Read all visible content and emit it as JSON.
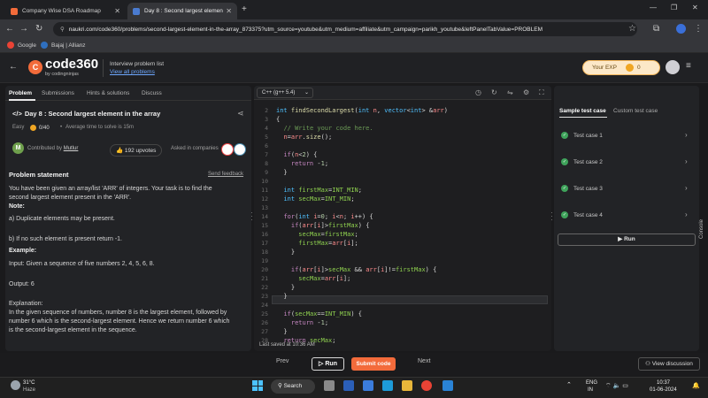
{
  "browser": {
    "tabs": [
      {
        "title": "Company Wise DSA Roadmap"
      },
      {
        "title": "Day 8 : Second largest elemen"
      }
    ],
    "url": "naukri.com/code360/problems/second-largest-element-in-the-array_873375?utm_source=youtube&utm_medium=affiliate&utm_campaign=parikh_youtube&leftPanelTabValue=PROBLEM",
    "bookmarks": [
      {
        "label": "Google"
      },
      {
        "label": "Bajaj | Allianz"
      }
    ]
  },
  "site": {
    "logo_text": "code360",
    "logo_sub": "by codingninjas",
    "ipl_title": "Interview problem list",
    "ipl_link": "View all problems",
    "exp_label": "Your EXP",
    "exp_value": "0"
  },
  "left_panel": {
    "tabs": [
      {
        "label": "Problem"
      },
      {
        "label": "Submissions"
      },
      {
        "label": "Hints & solutions"
      },
      {
        "label": "Discuss"
      }
    ],
    "title": "Day 8 : Second largest element in the array",
    "difficulty": "Easy",
    "score": "0/40",
    "avg_time": "Average time to solve is 15m",
    "contributor_initial": "M",
    "contributed_by": "Contributed by",
    "contributor_name": "Mutlur",
    "upvotes": "192 upvotes",
    "asked_in": "Asked in companies",
    "statement_title": "Problem statement",
    "send_feedback": "Send feedback",
    "statement_lines": [
      "You have been given an array/list 'ARR' of integers. Your task is to find the",
      "second largest element present in the 'ARR'."
    ],
    "note": "Note:",
    "note_a": "a) Duplicate elements may be present.",
    "note_b": "b) If no such element is present return -1.",
    "example": "Example:",
    "input": "Input: Given a sequence of five numbers 2, 4, 5, 6, 8.",
    "output": "Output:  6",
    "explanation": "Explanation:",
    "explanation_lines": [
      "In the given sequence of numbers, number 8 is the largest element, followed by",
      "number 6 which is the second-largest element. Hence we return number 6 which",
      "is the second-largest element in the sequence."
    ]
  },
  "editor": {
    "language": "C++ (g++ 5.4)",
    "last_saved": "Last saved at 10:36 AM",
    "line_numbers": [
      "2",
      "3",
      "4",
      "5",
      "6",
      "7",
      "8",
      "9",
      "10",
      "11",
      "12",
      "13",
      "14",
      "15",
      "16",
      "17",
      "18",
      "19",
      "20",
      "21",
      "22",
      "23",
      "24",
      "25",
      "26",
      "27",
      "28"
    ]
  },
  "right_panel": {
    "tab_sample": "Sample test case",
    "tab_custom": "Custom test case",
    "test_cases": [
      {
        "label": "Test case 1"
      },
      {
        "label": "Test case 2"
      },
      {
        "label": "Test case 3"
      },
      {
        "label": "Test case 4"
      }
    ],
    "run_label": "Run",
    "console_label": "Console"
  },
  "bottom_bar": {
    "prev": "Prev",
    "run": "Run",
    "submit": "Submit code",
    "next": "Next",
    "view_discussion": "View discussion"
  },
  "taskbar": {
    "temp": "31°C",
    "weather": "Haze",
    "search": "Search",
    "lang1": "ENG",
    "lang2": "IN",
    "time": "10:37",
    "date": "01-06-2024"
  }
}
